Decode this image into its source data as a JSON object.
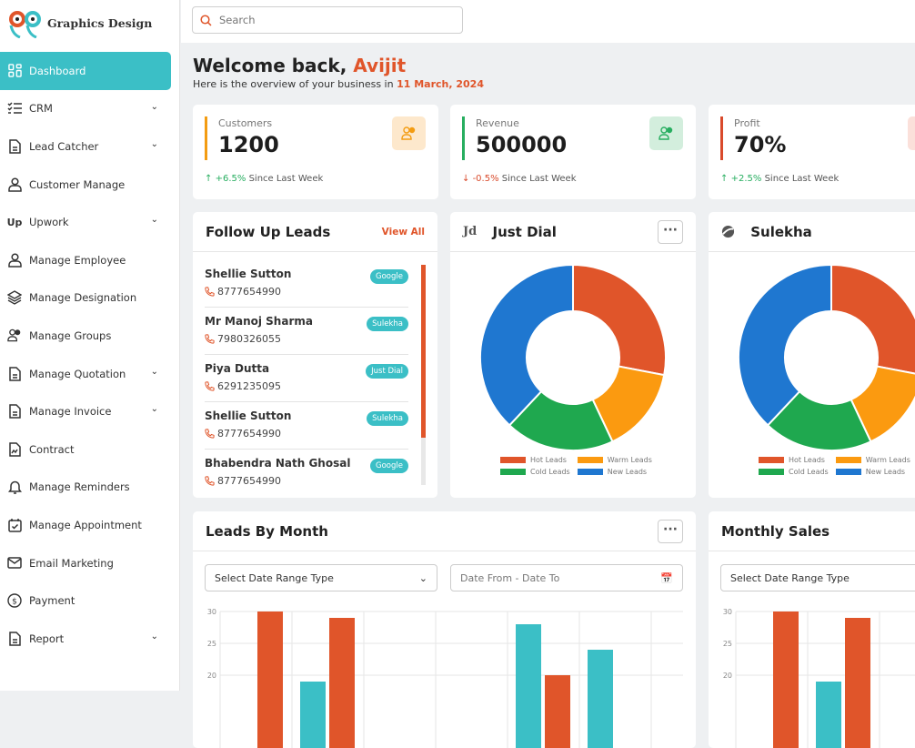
{
  "brand": {
    "name": "Graphics Design"
  },
  "sidebar": {
    "items": [
      {
        "label": "Dashboard",
        "icon": "dashboard-icon",
        "active": true
      },
      {
        "label": "CRM",
        "icon": "checklist-icon",
        "chevron": true
      },
      {
        "label": "Lead Catcher",
        "icon": "document-icon",
        "chevron": true
      },
      {
        "label": "Customer Manage",
        "icon": "user-icon"
      },
      {
        "label": "Upwork",
        "icon": "upwork-icon",
        "chevron": true
      },
      {
        "label": "Manage Employee",
        "icon": "user-icon"
      },
      {
        "label": "Manage Designation",
        "icon": "layers-icon"
      },
      {
        "label": "Manage Groups",
        "icon": "users-icon"
      },
      {
        "label": "Manage Quotation",
        "icon": "document-icon",
        "chevron": true
      },
      {
        "label": "Manage Invoice",
        "icon": "document-icon",
        "chevron": true
      },
      {
        "label": "Contract",
        "icon": "contract-icon"
      },
      {
        "label": "Manage Reminders",
        "icon": "bell-icon"
      },
      {
        "label": "Manage Appointment",
        "icon": "calendar-check-icon"
      },
      {
        "label": "Email Marketing",
        "icon": "mail-icon"
      },
      {
        "label": "Payment",
        "icon": "dollar-icon"
      },
      {
        "label": "Report",
        "icon": "document-icon",
        "chevron": true
      }
    ]
  },
  "search": {
    "placeholder": "Search"
  },
  "welcome": {
    "greeting": "Welcome back, ",
    "name": "Avijit",
    "subtitle": "Here is the overview of your business in ",
    "date": "11 March, 2024"
  },
  "stats": [
    {
      "label": "Customers",
      "value": "1200",
      "change": "+6.5%",
      "direction": "up",
      "suffix": "Since Last Week",
      "color": "#f39c12",
      "badge_bg": "#fde8cc"
    },
    {
      "label": "Revenue",
      "value": "500000",
      "change": "-0.5%",
      "direction": "down",
      "suffix": "Since Last Week",
      "color": "#27ae60",
      "badge_bg": "#d3eedd"
    },
    {
      "label": "Profit",
      "value": "70%",
      "change": "+2.5%",
      "direction": "up",
      "suffix": "Since Last Week",
      "color": "#d94a2b",
      "badge_bg": "#fbe0da"
    }
  ],
  "follow_up": {
    "title": "Follow Up Leads",
    "view_all": "View All",
    "leads": [
      {
        "name": "Shellie Sutton",
        "phone": "8777654990",
        "source": "Google"
      },
      {
        "name": "Mr Manoj Sharma",
        "phone": "7980326055",
        "source": "Sulekha"
      },
      {
        "name": "Piya Dutta",
        "phone": "6291235095",
        "source": "Just Dial"
      },
      {
        "name": "Shellie Sutton",
        "phone": "8777654990",
        "source": "Sulekha"
      },
      {
        "name": "Bhabendra Nath Ghosal",
        "phone": "8777654990",
        "source": "Google"
      }
    ]
  },
  "justdial": {
    "title": "Just Dial",
    "logo": "Jd",
    "more": "···"
  },
  "sulekha": {
    "title": "Sulekha"
  },
  "leads_by_month": {
    "title": "Leads By Month",
    "more": "···",
    "range_select": "Select Date Range Type",
    "date_placeholder": "Date From - Date To"
  },
  "monthly_sales": {
    "title": "Monthly Sales",
    "range_select": "Select Date Range Type"
  },
  "colors": {
    "accent": "#3bbfc6",
    "orange": "#e0552a"
  },
  "chart_data": [
    {
      "type": "pie",
      "donut": true,
      "labels": [
        "Hot Leads",
        "Warm Leads",
        "Cold Leads",
        "New Leads"
      ],
      "values": [
        28,
        15,
        19,
        38
      ],
      "colors": [
        "#e0552a",
        "#fb9a10",
        "#1fa84f",
        "#1f77d0"
      ],
      "legend": "bottom"
    },
    {
      "type": "pie",
      "donut": true,
      "labels": [
        "Hot Leads",
        "Warm Leads",
        "Cold Leads",
        "New Leads"
      ],
      "values": [
        28,
        15,
        19,
        38
      ],
      "colors": [
        "#e0552a",
        "#fb9a10",
        "#1fa84f",
        "#1f77d0"
      ],
      "legend": "bottom"
    },
    {
      "type": "bar",
      "yticks": [
        "30",
        "25",
        "20"
      ],
      "ylim": [
        0,
        30
      ],
      "grid": true,
      "series": [
        {
          "color": "#3bbfc6",
          "values": [
            null,
            19,
            null,
            null,
            28,
            24
          ]
        },
        {
          "color": "#e0552a",
          "values": [
            30,
            29,
            null,
            null,
            20,
            null
          ]
        }
      ]
    },
    {
      "type": "bar",
      "yticks": [
        "30",
        "25",
        "20"
      ],
      "ylim": [
        0,
        30
      ],
      "grid": true,
      "series": [
        {
          "color": "#3bbfc6",
          "values": [
            null,
            19
          ]
        },
        {
          "color": "#e0552a",
          "values": [
            30,
            29
          ]
        }
      ]
    }
  ]
}
